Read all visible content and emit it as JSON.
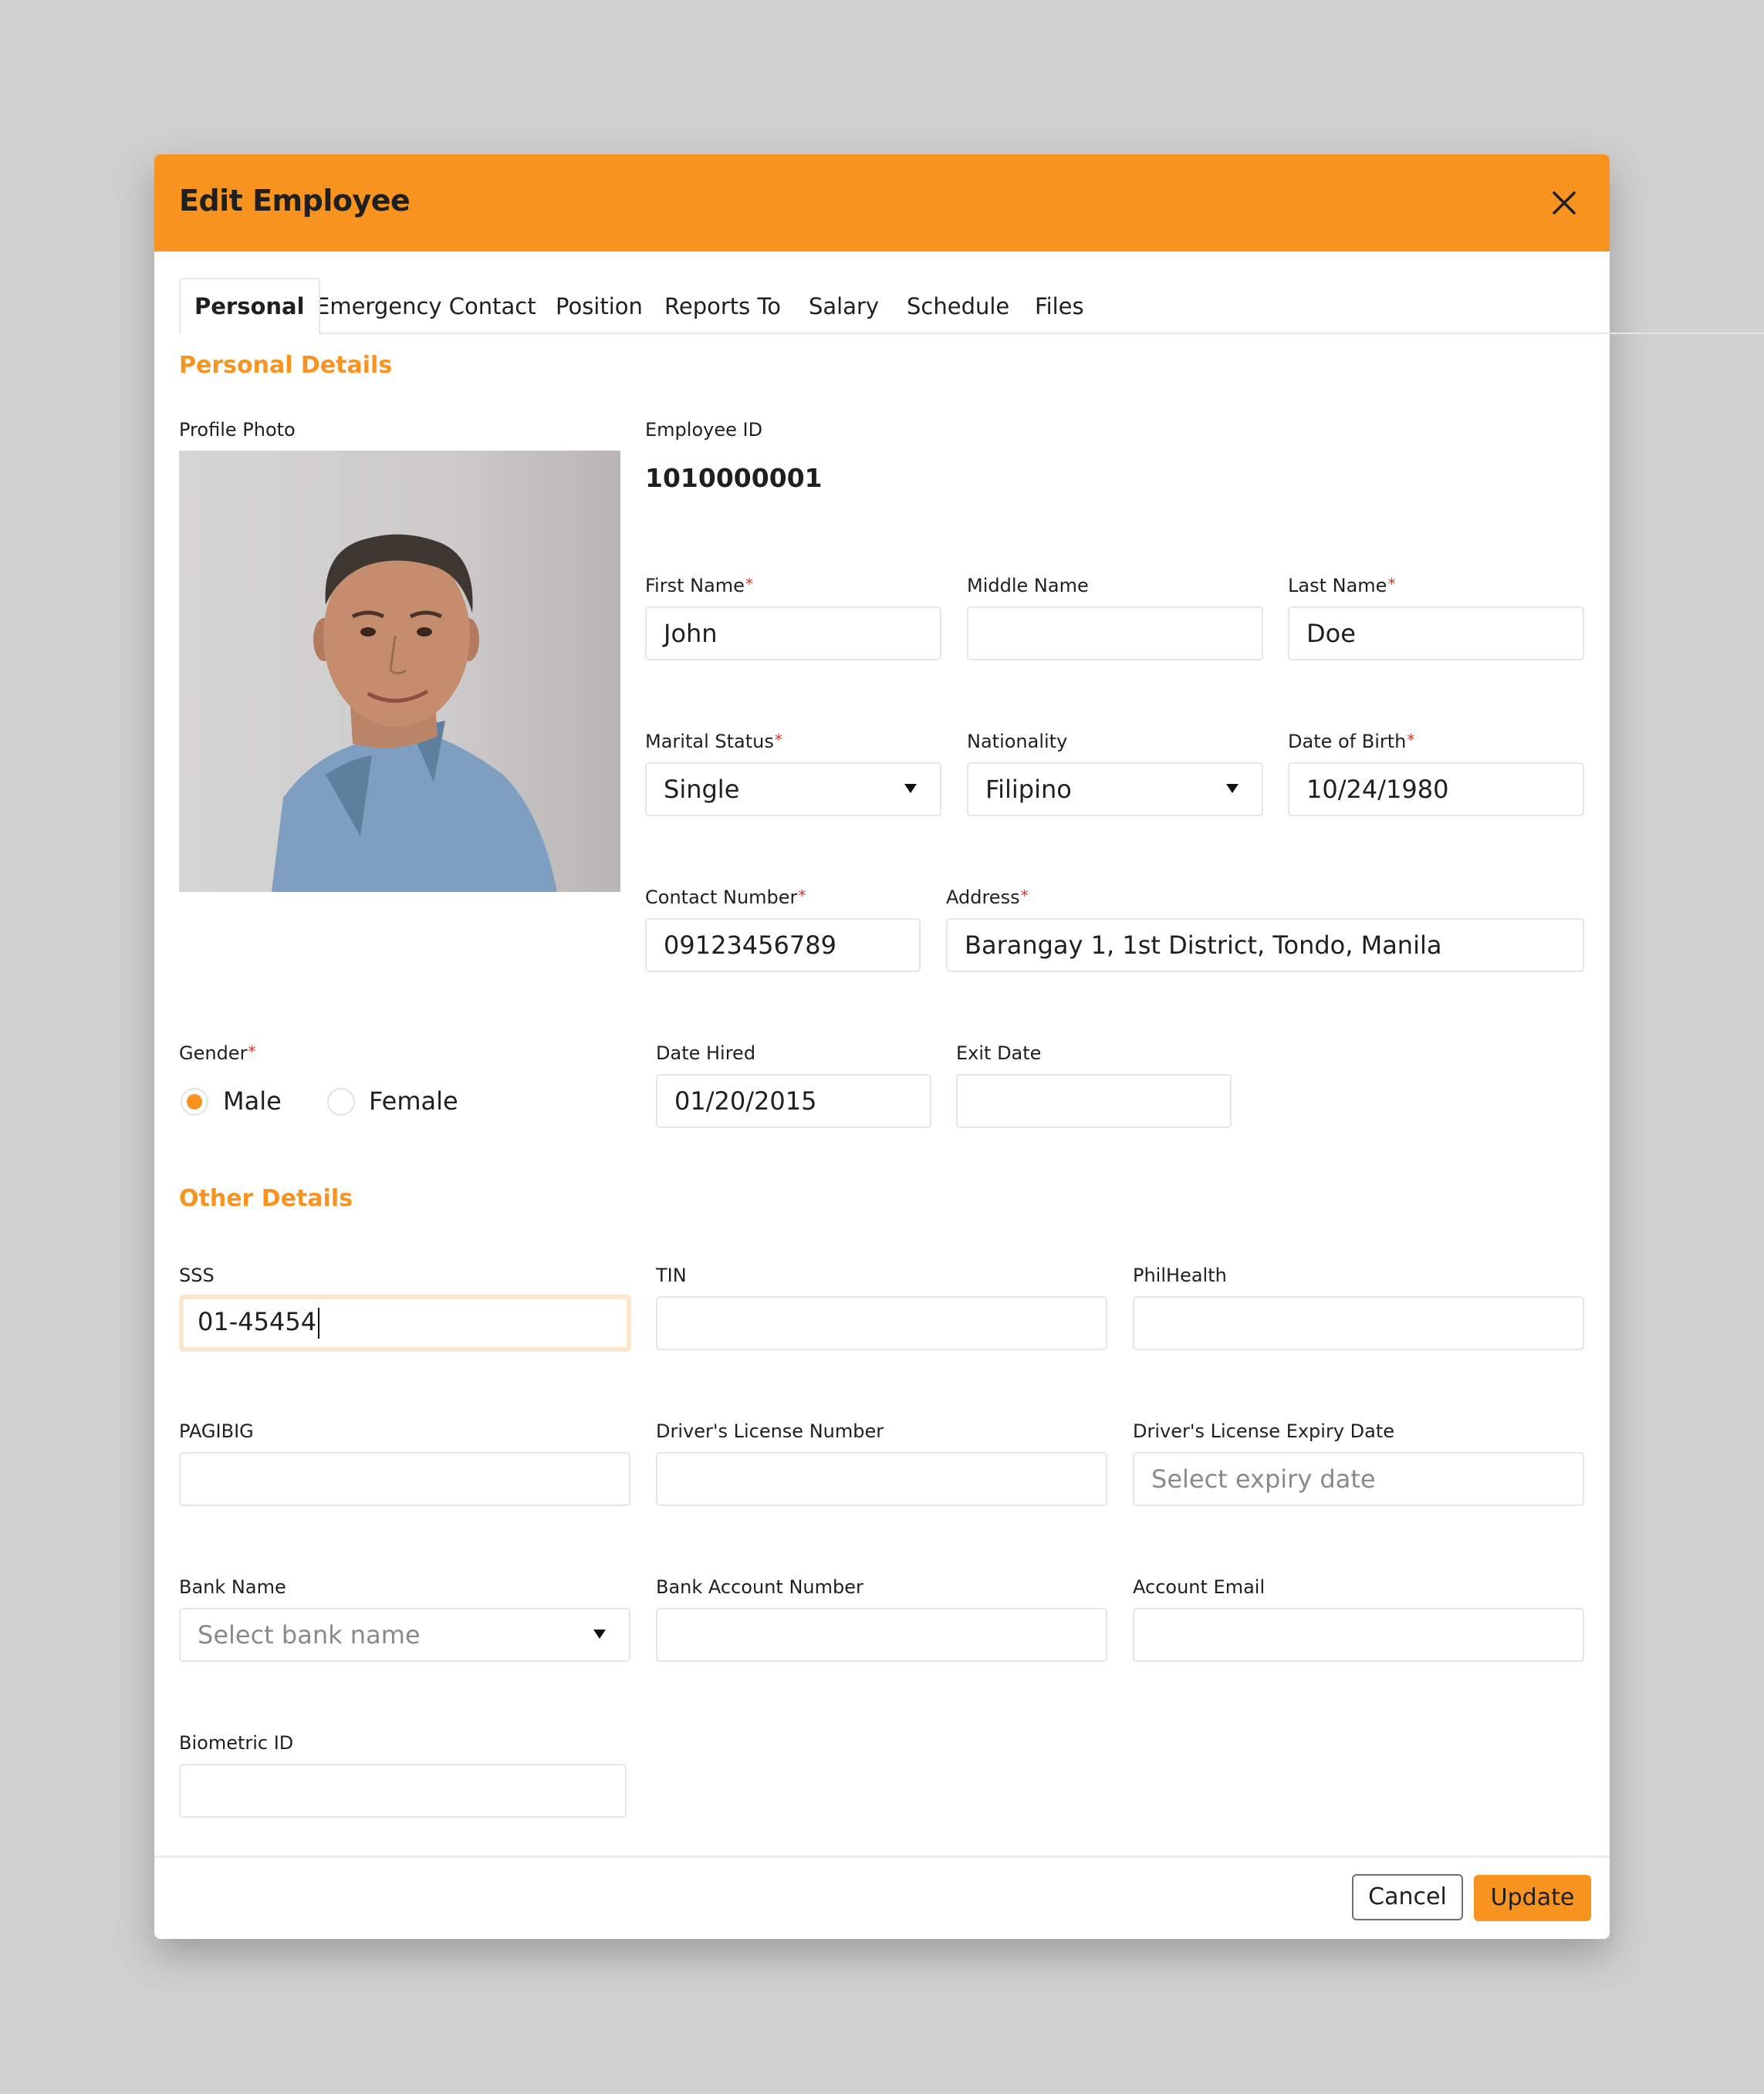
{
  "modal": {
    "title": "Edit Employee",
    "close_icon": "close-icon",
    "accent_color": "#f7931e"
  },
  "tabs": [
    {
      "label": "Personal",
      "active": true
    },
    {
      "label": "Emergency Contact",
      "active": false
    },
    {
      "label": "Position",
      "active": false
    },
    {
      "label": "Reports To",
      "active": false
    },
    {
      "label": "Salary",
      "active": false
    },
    {
      "label": "Schedule",
      "active": false
    },
    {
      "label": "Files",
      "active": false
    }
  ],
  "personal": {
    "section_title": "Personal Details",
    "profile_photo_label": "Profile Photo",
    "employee_id_label": "Employee ID",
    "employee_id": "1010000001",
    "first_name": {
      "label": "First Name",
      "value": "John",
      "required": "*"
    },
    "middle_name": {
      "label": "Middle Name",
      "value": ""
    },
    "last_name": {
      "label": "Last Name",
      "value": "Doe",
      "required": "*"
    },
    "marital_status": {
      "label": "Marital Status",
      "value": "Single",
      "required": "*"
    },
    "nationality": {
      "label": "Nationality",
      "value": "Filipino"
    },
    "date_of_birth": {
      "label": "Date of Birth",
      "value": "10/24/1980",
      "required": "*"
    },
    "contact_number": {
      "label": "Contact Number",
      "value": "09123456789",
      "required": "*"
    },
    "address": {
      "label": "Address",
      "value": "Barangay 1, 1st District, Tondo, Manila",
      "required": "*"
    },
    "gender": {
      "label": "Gender",
      "required": "*",
      "options": [
        "Male",
        "Female"
      ],
      "selected": "Male"
    },
    "date_hired": {
      "label": "Date Hired",
      "value": "01/20/2015"
    },
    "exit_date": {
      "label": "Exit Date",
      "value": ""
    }
  },
  "other": {
    "section_title": "Other Details",
    "sss": {
      "label": "SSS",
      "value": "01-45454"
    },
    "tin": {
      "label": "TIN",
      "value": ""
    },
    "philhealth": {
      "label": "PhilHealth",
      "value": ""
    },
    "pagibig": {
      "label": "PAGIBIG",
      "value": ""
    },
    "license_number": {
      "label": "Driver's License Number",
      "value": ""
    },
    "license_expiry": {
      "label": "Driver's License Expiry Date",
      "placeholder": "Select expiry date"
    },
    "bank_name": {
      "label": "Bank Name",
      "placeholder": "Select bank name"
    },
    "bank_account": {
      "label": "Bank Account Number",
      "value": ""
    },
    "account_email": {
      "label": "Account Email",
      "value": ""
    },
    "biometric_id": {
      "label": "Biometric ID",
      "value": ""
    }
  },
  "footer": {
    "cancel_label": "Cancel",
    "update_label": "Update"
  }
}
